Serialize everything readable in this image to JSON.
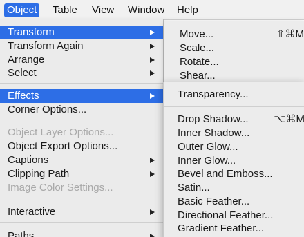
{
  "menubar": {
    "items": [
      "Object",
      "Table",
      "View",
      "Window",
      "Help"
    ],
    "active": "Object"
  },
  "menu": {
    "items": [
      {
        "label": "Transform",
        "submenu": true,
        "state": "highlighted"
      },
      {
        "label": "Transform Again",
        "submenu": true,
        "state": "enabled"
      },
      {
        "label": "Arrange",
        "submenu": true,
        "state": "enabled"
      },
      {
        "label": "Select",
        "submenu": true,
        "state": "enabled"
      },
      {
        "label": "Effects",
        "submenu": true,
        "state": "highlighted"
      },
      {
        "label": "Corner Options...",
        "submenu": false,
        "state": "enabled"
      },
      {
        "label": "Object Layer Options...",
        "submenu": false,
        "state": "disabled"
      },
      {
        "label": "Object Export Options...",
        "submenu": false,
        "state": "enabled"
      },
      {
        "label": "Captions",
        "submenu": true,
        "state": "enabled"
      },
      {
        "label": "Clipping Path",
        "submenu": true,
        "state": "enabled"
      },
      {
        "label": "Image Color Settings...",
        "submenu": false,
        "state": "disabled"
      },
      {
        "label": "Interactive",
        "submenu": true,
        "state": "enabled"
      },
      {
        "label": "Paths",
        "submenu": true,
        "state": "enabled"
      }
    ]
  },
  "transform_submenu": {
    "items": [
      {
        "label": "Move...",
        "shortcut": "⇧⌘M"
      },
      {
        "label": "Scale...",
        "shortcut": ""
      },
      {
        "label": "Rotate...",
        "shortcut": ""
      },
      {
        "label": "Shear...",
        "shortcut": ""
      }
    ]
  },
  "effects_submenu": {
    "items": [
      {
        "label": "Transparency...",
        "shortcut": ""
      },
      {
        "label": "Drop Shadow...",
        "shortcut": "⌥⌘M"
      },
      {
        "label": "Inner Shadow...",
        "shortcut": ""
      },
      {
        "label": "Outer Glow...",
        "shortcut": ""
      },
      {
        "label": "Inner Glow...",
        "shortcut": ""
      },
      {
        "label": "Bevel and Emboss...",
        "shortcut": ""
      },
      {
        "label": "Satin...",
        "shortcut": ""
      },
      {
        "label": "Basic Feather...",
        "shortcut": ""
      },
      {
        "label": "Directional Feather...",
        "shortcut": ""
      },
      {
        "label": "Gradient Feather...",
        "shortcut": ""
      }
    ]
  },
  "colors": {
    "highlight": "#2d6ee6",
    "menu_bg": "#ebebeb",
    "disabled_text": "#a9a9a9"
  }
}
